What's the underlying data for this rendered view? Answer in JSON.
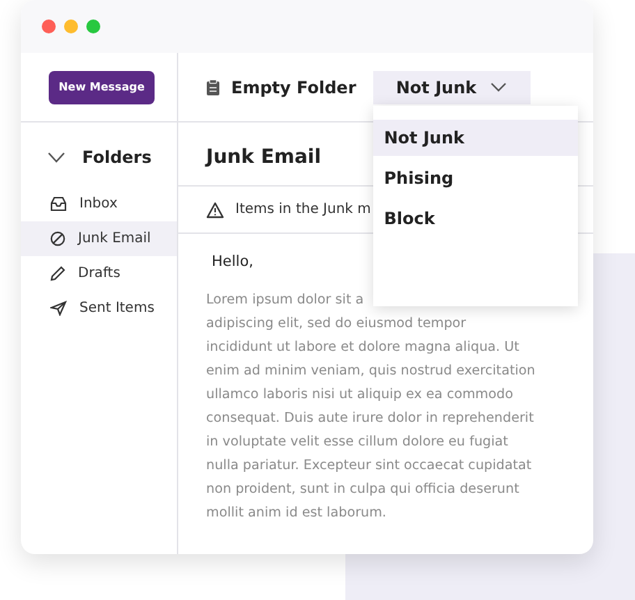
{
  "window": {
    "controls": [
      {
        "color": "#fe5f57"
      },
      {
        "color": "#febc2e"
      },
      {
        "color": "#28c840"
      }
    ]
  },
  "sidebar": {
    "new_message_button": "New Message",
    "folders": {
      "label": "Folders",
      "expanded": true
    },
    "items": [
      {
        "label": "Inbox",
        "selected": false
      },
      {
        "label": "Junk Email",
        "selected": true
      },
      {
        "label": "Drafts",
        "selected": false
      },
      {
        "label": "Sent Items",
        "selected": false
      }
    ]
  },
  "toolbar": {
    "empty_folder": "Empty Folder",
    "dropdown": {
      "label": "Not Junk",
      "expanded": true,
      "options": [
        {
          "label": "Not Junk",
          "selected": true
        },
        {
          "label": "Phising",
          "selected": false
        },
        {
          "label": "Block",
          "selected": false
        }
      ]
    }
  },
  "message": {
    "folder_title": "Junk Email",
    "notice": "Items in the Junk m",
    "greeting": "Hello,",
    "body_lines": [
      "Lorem ipsum dolor sit a",
      "adipiscing elit, sed do eiusmod tempor",
      "incididunt ut labore et dolore magna aliqua. Ut",
      "enim ad minim veniam, quis nostrud exercitation",
      "ullamco laboris nisi ut aliquip ex ea commodo",
      "consequat. Duis aute irure dolor in reprehenderit",
      "in voluptate velit esse cillum dolore eu fugiat",
      "nulla pariatur. Excepteur sint occaecat cupidatat",
      "non proident, sunt in culpa qui officia deserunt",
      "mollit anim id est laborum."
    ]
  }
}
